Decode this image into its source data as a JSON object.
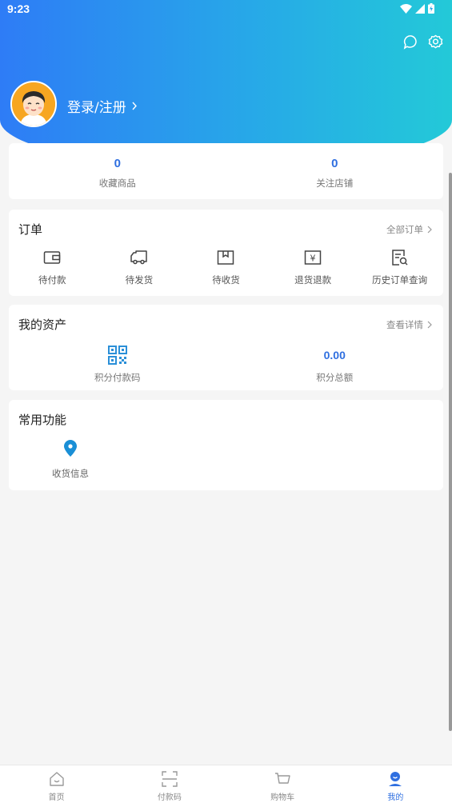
{
  "status_bar": {
    "time": "9:23"
  },
  "header": {
    "login_label": "登录/注册"
  },
  "stats": [
    {
      "value": "0",
      "label": "收藏商品"
    },
    {
      "value": "0",
      "label": "关注店铺"
    }
  ],
  "orders": {
    "title": "订单",
    "link": "全部订单",
    "items": [
      {
        "label": "待付款",
        "icon": "wallet-icon"
      },
      {
        "label": "待发货",
        "icon": "truck-icon"
      },
      {
        "label": "待收货",
        "icon": "package-icon"
      },
      {
        "label": "退货退款",
        "icon": "refund-icon"
      },
      {
        "label": "历史订单查询",
        "icon": "order-search-icon"
      }
    ]
  },
  "assets": {
    "title": "我的资产",
    "link": "查看详情",
    "items": [
      {
        "label": "积分付款码",
        "icon": "qr-code-icon"
      },
      {
        "label": "积分总额",
        "value": "0.00"
      }
    ]
  },
  "functions": {
    "title": "常用功能",
    "items": [
      {
        "label": "收货信息",
        "icon": "location-pin-icon"
      }
    ]
  },
  "tabbar": [
    {
      "label": "首页",
      "icon": "home-icon"
    },
    {
      "label": "付款码",
      "icon": "scan-icon"
    },
    {
      "label": "购物车",
      "icon": "cart-icon"
    },
    {
      "label": "我的",
      "icon": "profile-icon",
      "active": true
    }
  ],
  "colors": {
    "accent": "#2f6fe0",
    "gradient_start": "#2e7cf6",
    "gradient_end": "#23c9d8"
  }
}
